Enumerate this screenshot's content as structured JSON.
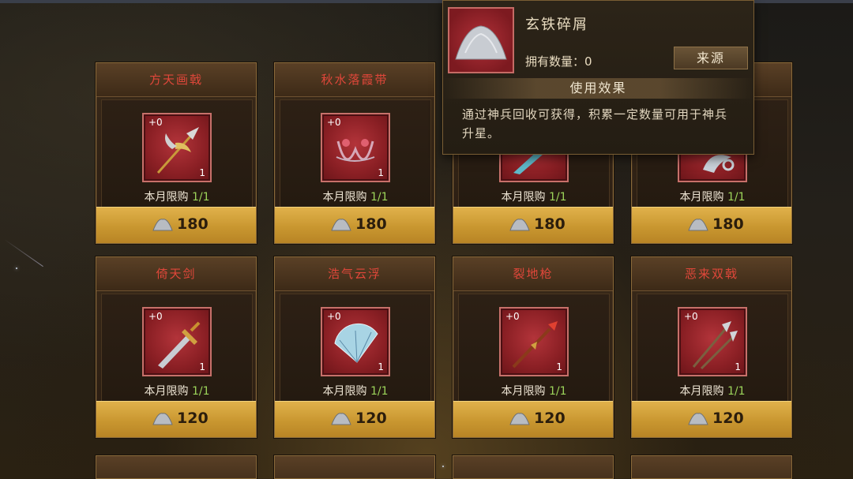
{
  "shop": {
    "items": [
      {
        "name": "方天画戟",
        "plus": "+0",
        "count": "1",
        "limit_label": "本月限购",
        "limit_ratio": "1/1",
        "price": "180",
        "art": "halberd-icon"
      },
      {
        "name": "秋水落霞带",
        "plus": "+0",
        "count": "1",
        "limit_label": "本月限购",
        "limit_ratio": "1/1",
        "price": "180",
        "art": "ribbon-icon"
      },
      {
        "name": "",
        "plus": "",
        "count": "",
        "limit_label": "本月限购",
        "limit_ratio": "1/1",
        "price": "180",
        "art": "blade-icon"
      },
      {
        "name": "",
        "plus": "",
        "count": "",
        "limit_label": "本月限购",
        "limit_ratio": "1/1",
        "price": "180",
        "art": "hook-icon"
      },
      {
        "name": "倚天剑",
        "plus": "+0",
        "count": "1",
        "limit_label": "本月限购",
        "limit_ratio": "1/1",
        "price": "120",
        "art": "sword-icon"
      },
      {
        "name": "浩气云浮",
        "plus": "+0",
        "count": "1",
        "limit_label": "本月限购",
        "limit_ratio": "1/1",
        "price": "120",
        "art": "fan-icon"
      },
      {
        "name": "裂地枪",
        "plus": "+0",
        "count": "1",
        "limit_label": "本月限购",
        "limit_ratio": "1/1",
        "price": "120",
        "art": "spear-icon"
      },
      {
        "name": "恶来双戟",
        "plus": "+0",
        "count": "1",
        "limit_label": "本月限购",
        "limit_ratio": "1/1",
        "price": "120",
        "art": "twin-halberd-icon"
      }
    ],
    "partial_row": [
      "",
      "",
      "",
      ""
    ]
  },
  "tooltip": {
    "name": "玄铁碎屑",
    "owned_label": "拥有数量：0",
    "source_button": "来源",
    "effect_title": "使用效果",
    "description": "通过神兵回收可获得，积累一定数量可用于神兵升星。"
  },
  "colors": {
    "title_red": "#e0473a",
    "limit_green": "#9cd45a",
    "gold_bar": "#c99730"
  }
}
